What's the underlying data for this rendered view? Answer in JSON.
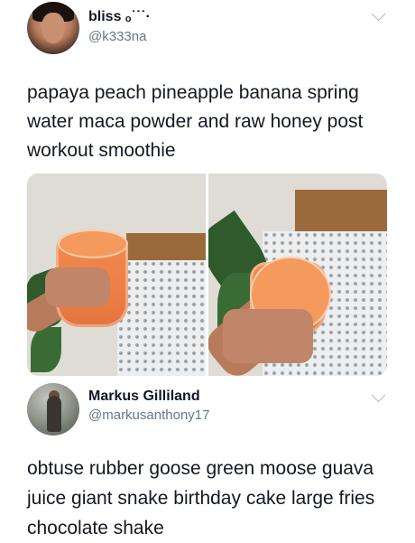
{
  "tweets": [
    {
      "display_name": "bliss ₒ˙˙˙·",
      "handle": "@k333na",
      "text": "papaya peach pineapple banana spring water maca powder and raw honey post workout smoothie",
      "has_photos": true
    },
    {
      "display_name": "Markus Gilliland",
      "handle": "@markusanthony17",
      "text": "obtuse rubber goose green moose guava juice giant snake birthday cake large fries chocolate shake"
    }
  ],
  "icons": {
    "menu": "chevron-down-icon"
  },
  "colors": {
    "text": "#141823",
    "handle": "#657786",
    "smoothie": "#ee7f45"
  }
}
